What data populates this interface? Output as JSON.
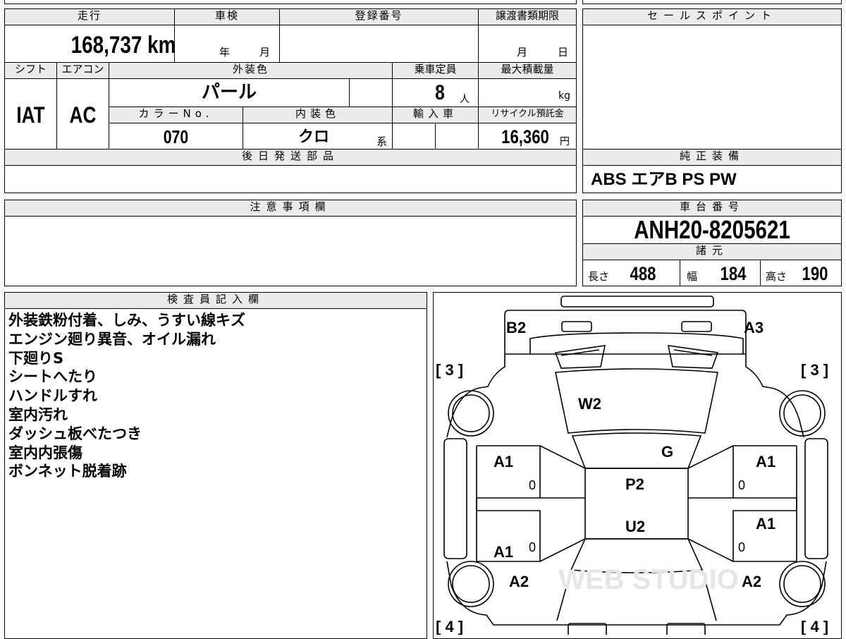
{
  "top_left": {
    "headers": {
      "mileage": "走行",
      "inspection": "車検",
      "registration": "登録番号",
      "transfer_deadline": "譲渡書類期限"
    },
    "mileage_value": "168,737 km",
    "inspection_year": "年",
    "inspection_month": "月",
    "deadline_month": "月",
    "deadline_day": "日"
  },
  "row2": {
    "headers": {
      "shift": "シフト",
      "aircon": "エアコン",
      "exterior_color": "外装色",
      "capacity": "乗車定員",
      "max_load": "最大積載量",
      "color_no": "カラーNo.",
      "interior_color": "内装色",
      "import": "輸入車",
      "recycle_fee": "リサイクル預託金"
    },
    "shift_value": "IAT",
    "aircon_value": "AC",
    "exterior_color_value": "パール",
    "capacity_value": "8",
    "capacity_unit": "人",
    "max_load_unit": "kg",
    "color_no_value": "070",
    "interior_color_value": "クロ",
    "interior_color_suffix": "系",
    "recycle_fee_value": "16,360",
    "recycle_fee_unit": "円"
  },
  "later_parts": {
    "header": "後日発送部品"
  },
  "caution": {
    "header": "注意事項欄"
  },
  "sales_point": {
    "header": "セールスポイント"
  },
  "genuine_equipment": {
    "header": "純正装備",
    "value": "ABS エアB PS PW"
  },
  "chassis": {
    "header": "車台番号",
    "value": "ANH20-8205621"
  },
  "specs": {
    "header": "諸元",
    "length_label": "長さ",
    "length_value": "488",
    "width_label": "幅",
    "width_value": "184",
    "height_label": "高さ",
    "height_value": "190"
  },
  "inspector": {
    "header": "検査員記入欄",
    "notes": [
      "外装鉄粉付着、しみ、うすい線キズ",
      "エンジン廻り異音、オイル漏れ",
      "下廻りS",
      "シートへたり",
      "ハンドルすれ",
      "室内汚れ",
      "ダッシュ板べたつき",
      "室内内張傷",
      "ボンネット脱着跡"
    ]
  },
  "diagram": {
    "labels": {
      "b2": "B2",
      "a3": "A3",
      "w2": "W2",
      "g": "G",
      "a1_fl": "A1",
      "a1_fr": "A1",
      "a1_rl": "A1",
      "a1_rr": "A1",
      "p2": "P2",
      "u2": "U2",
      "a2_l": "A2",
      "a2_r": "A2",
      "tire_fl": "[ 3 ]",
      "tire_fr": "[ 3 ]",
      "tire_rl": "[ 4 ]",
      "tire_rr": "[ 4 ]",
      "zero_1": "0",
      "zero_2": "0",
      "zero_3": "0",
      "zero_4": "0"
    },
    "watermark": "WEB STUDIO"
  }
}
